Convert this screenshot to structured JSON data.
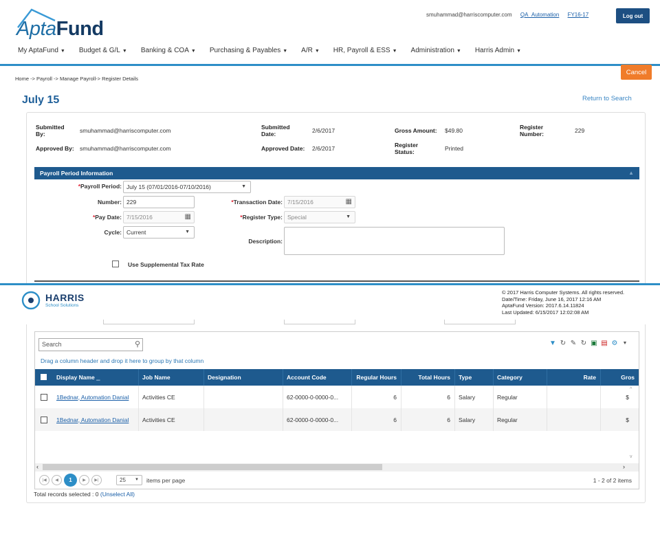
{
  "header": {
    "logo": {
      "apta": "Apta",
      "fund": "Fund"
    },
    "user_email": "smuhammad@harriscomputer.com",
    "user_link": "QA_Automation",
    "fiscal_year": "FY16-17",
    "logout_label": "Log out"
  },
  "nav": [
    {
      "label": "My AptaFund"
    },
    {
      "label": "Budget & G/L"
    },
    {
      "label": "Banking & COA"
    },
    {
      "label": "Purchasing & Payables"
    },
    {
      "label": "A/R"
    },
    {
      "label": "HR, Payroll & ESS"
    },
    {
      "label": "Administration"
    },
    {
      "label": "Harris Admin"
    }
  ],
  "breadcrumb": "Home -> Payroll -> Manage Payroll-> Register Details",
  "cancel_label": "Cancel",
  "page_title": "July 15",
  "return_label": "Return to Search",
  "summary": {
    "submitted_by_label": "Submitted By:",
    "submitted_by": "smuhammad@harriscomputer.com",
    "submitted_date_label": "Submitted Date:",
    "submitted_date": "2/6/2017",
    "gross_amount_label": "Gross Amount:",
    "gross_amount": "$49.80",
    "register_number_label": "Register Number:",
    "register_number": "229",
    "approved_by_label": "Approved By:",
    "approved_by": "smuhammad@harriscomputer.com",
    "approved_date_label": "Approved Date:",
    "approved_date": "2/6/2017",
    "register_status_label": "Register Status:",
    "register_status": "Printed"
  },
  "period_section": {
    "title": "Payroll Period Information",
    "payroll_period_label": "Payroll Period:",
    "payroll_period": "July 15 (07/01/2016-07/10/2016)",
    "number_label": "Number:",
    "number": "229",
    "transaction_date_label": "Transaction Date:",
    "transaction_date": "7/15/2016",
    "pay_date_label": "Pay Date:",
    "pay_date": "7/15/2016",
    "register_type_label": "Register Type:",
    "register_type": "Special",
    "cycle_label": "Cycle:",
    "cycle": "Current",
    "description_label": "Description:",
    "supplemental_label": "Use Supplemental Tax Rate"
  },
  "footer": {
    "company": "HARRIS",
    "company_sub": "School Solutions",
    "copyright": "© 2017 Harris Computer Systems. All rights reserved.",
    "datetime": "Date/Time: Friday, June 16, 2017 12:16 AM",
    "version": "AptaFund Version: 2017.6.14.11824",
    "last_updated": "Last Updated: 6/15/2017 12:02:08 AM"
  },
  "grid": {
    "search_placeholder": "Search",
    "group_hint": "Drag a column header and drop it here to group by that column",
    "columns": {
      "display_name": "Display Name",
      "job_name": "Job Name",
      "designation": "Designation",
      "account_code": "Account Code",
      "regular_hours": "Regular Hours",
      "total_hours": "Total Hours",
      "type": "Type",
      "category": "Category",
      "rate": "Rate",
      "gross": "Gros"
    },
    "rows": [
      {
        "display_name": "1Bednar, Automation Danial",
        "job_name": "Activities CE",
        "designation": "",
        "account_code": "62-0000-0-0000-0...",
        "regular_hours": "6",
        "total_hours": "6",
        "type": "Salary",
        "category": "Regular",
        "rate": "",
        "gross": "$"
      },
      {
        "display_name": "1Bednar, Automation Danial",
        "job_name": "Activities CE",
        "designation": "",
        "account_code": "62-0000-0-0000-0...",
        "regular_hours": "6",
        "total_hours": "6",
        "type": "Salary",
        "category": "Regular",
        "rate": "",
        "gross": "$"
      }
    ],
    "pager": {
      "current_page": "1",
      "page_size": "25",
      "items_per_page": "items per page",
      "range": "1 - 2 of 2 items"
    },
    "total_selected": "Total records selected : 0",
    "unselect_all": "(Unselect All)"
  },
  "colors": {
    "brand_blue": "#1e5a8e",
    "accent_blue": "#2d8ec7",
    "cancel_orange": "#f07c2a"
  }
}
